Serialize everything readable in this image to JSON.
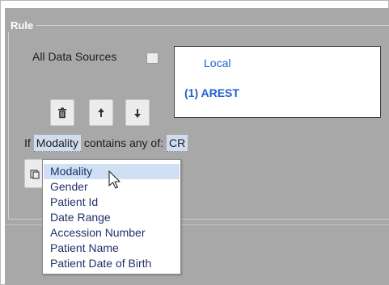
{
  "rule": {
    "legend": "Rule",
    "all_sources_label": "All Data Sources",
    "sources": [
      {
        "label": "Local"
      },
      {
        "label": "(1) AREST"
      }
    ],
    "toolbar": [
      {
        "name": "delete-button",
        "icon": "trash-icon"
      },
      {
        "name": "move-up-button",
        "icon": "arrow-up-icon"
      },
      {
        "name": "move-down-button",
        "icon": "arrow-down-icon"
      }
    ],
    "condition": {
      "prefix": "If",
      "field": "Modality",
      "operator": "contains any of:",
      "value": "CR"
    },
    "field_options": [
      "Modality",
      "Gender",
      "Patient Id",
      "Date Range",
      "Accession Number",
      "Patient Name",
      "Patient Date of Birth"
    ],
    "selected_option_index": 0
  },
  "colors": {
    "panel_bg": "#a8a8a8",
    "source_text": "#1f5fcf",
    "selection_bg": "#cfe0f4",
    "option_text": "#20306a"
  }
}
